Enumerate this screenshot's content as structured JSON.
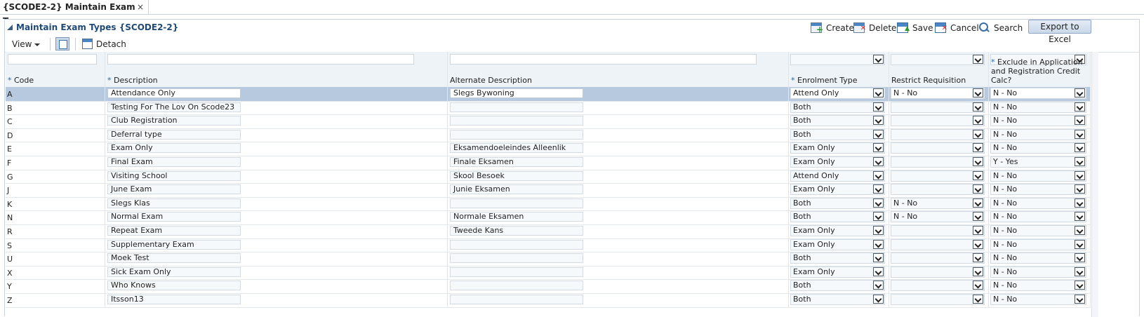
{
  "tab": {
    "title": "{SCODE2-2} Maintain Exam Types",
    "close": "×"
  },
  "panel": {
    "title": "Maintain Exam Types {SCODE2-2}",
    "toolbar": {
      "create": "Create",
      "delete": "Delete",
      "save": "Save",
      "cancel": "Cancel",
      "search": "Search",
      "export": "Export to Excel"
    },
    "view_label": "View",
    "detach_label": "Detach"
  },
  "columns": [
    {
      "label": "Code",
      "required": true
    },
    {
      "label": "Description",
      "required": true
    },
    {
      "label": "Alternate Description",
      "required": false
    },
    {
      "label": "Enrolment Type",
      "required": true
    },
    {
      "label": "Restrict Requisition",
      "required": false
    },
    {
      "label": "Exclude in Application and Registration Credit Calc?",
      "required": true
    }
  ],
  "required_marker": "*",
  "rows": [
    {
      "code": "A",
      "description": "Attendance Only",
      "alt": "Slegs Bywoning",
      "enrol": "Attend Only",
      "restrict": "N - No",
      "exclude": "N - No",
      "selected": true
    },
    {
      "code": "B",
      "description": "Testing For The Lov On Scode23",
      "alt": "",
      "enrol": "Both",
      "restrict": "",
      "exclude": "N - No"
    },
    {
      "code": "C",
      "description": "Club Registration",
      "alt": "",
      "enrol": "Both",
      "restrict": "",
      "exclude": "N - No"
    },
    {
      "code": "D",
      "description": "Deferral type",
      "alt": "",
      "enrol": "Both",
      "restrict": "",
      "exclude": "N - No"
    },
    {
      "code": "E",
      "description": "Exam Only",
      "alt": "Eksamendoeleindes Alleenlik",
      "enrol": "Exam Only",
      "restrict": "",
      "exclude": "N - No"
    },
    {
      "code": "F",
      "description": "Final Exam",
      "alt": "Finale Eksamen",
      "enrol": "Exam Only",
      "restrict": "",
      "exclude": "Y - Yes"
    },
    {
      "code": "G",
      "description": "Visiting School",
      "alt": "Skool Besoek",
      "enrol": "Attend Only",
      "restrict": "",
      "exclude": "N - No"
    },
    {
      "code": "J",
      "description": "June Exam",
      "alt": "Junie Eksamen",
      "enrol": "Exam Only",
      "restrict": "",
      "exclude": "N - No"
    },
    {
      "code": "K",
      "description": "Slegs Klas",
      "alt": "",
      "enrol": "Both",
      "restrict": "N - No",
      "exclude": "N - No"
    },
    {
      "code": "N",
      "description": "Normal Exam",
      "alt": "Normale Eksamen",
      "enrol": "Both",
      "restrict": "N - No",
      "exclude": "N - No"
    },
    {
      "code": "R",
      "description": "Repeat Exam",
      "alt": "Tweede Kans",
      "enrol": "Exam Only",
      "restrict": "",
      "exclude": "N - No"
    },
    {
      "code": "S",
      "description": "Supplementary Exam",
      "alt": "",
      "enrol": "Exam Only",
      "restrict": "",
      "exclude": "N - No"
    },
    {
      "code": "U",
      "description": "Moek Test",
      "alt": "",
      "enrol": "Both",
      "restrict": "",
      "exclude": "N - No"
    },
    {
      "code": "X",
      "description": "Sick Exam Only",
      "alt": "",
      "enrol": "Exam Only",
      "restrict": "",
      "exclude": "N - No"
    },
    {
      "code": "Y",
      "description": "Who Knows",
      "alt": "",
      "enrol": "Both",
      "restrict": "",
      "exclude": "N - No"
    },
    {
      "code": "Z",
      "description": "Itsson13",
      "alt": "",
      "enrol": "Both",
      "restrict": "",
      "exclude": "N - No"
    }
  ]
}
